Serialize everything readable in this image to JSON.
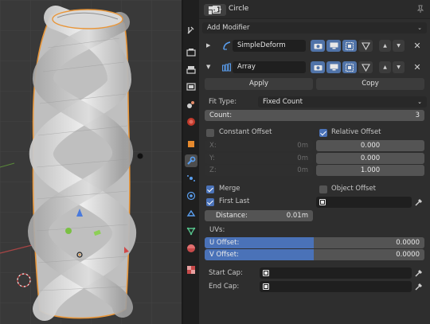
{
  "header": {
    "object_name": "Circle",
    "editor_type_icon": "properties-editor-icon",
    "object_icon": "mesh-object-icon",
    "pin_icon": "pin-icon"
  },
  "add_modifier": {
    "label": "Add Modifier"
  },
  "modifiers": [
    {
      "name": "SimpleDeform",
      "expanded": false,
      "icon": "simple-deform-icon"
    },
    {
      "name": "Array",
      "expanded": true,
      "icon": "array-modifier-icon"
    }
  ],
  "array": {
    "apply_label": "Apply",
    "copy_label": "Copy",
    "fit_type_label": "Fit Type:",
    "fit_type_value": "Fixed Count",
    "count_label": "Count:",
    "count_value": "3",
    "constant_offset_label": "Constant Offset",
    "constant_offset_checked": false,
    "relative_offset_label": "Relative Offset",
    "relative_offset_checked": true,
    "constant": {
      "x_label": "X:",
      "x_value": "0m",
      "y_label": "Y:",
      "y_value": "0m",
      "z_label": "Z:",
      "z_value": "0m"
    },
    "relative": {
      "x_value": "0.000",
      "y_value": "0.000",
      "z_value": "1.000"
    },
    "merge_label": "Merge",
    "merge_checked": true,
    "object_offset_label": "Object Offset",
    "object_offset_checked": false,
    "first_last_label": "First Last",
    "first_last_checked": true,
    "distance_label": "Distance:",
    "distance_value": "0.01m",
    "uvs_label": "UVs:",
    "u_offset_label": "U Offset:",
    "u_offset_value": "0.0000",
    "v_offset_label": "V Offset:",
    "v_offset_value": "0.0000",
    "start_cap_label": "Start Cap:",
    "end_cap_label": "End Cap:"
  },
  "tool_tabs": [
    {
      "icon": "tool-settings-icon"
    },
    {
      "icon": "render-icon"
    },
    {
      "icon": "output-icon"
    },
    {
      "icon": "view-layer-icon"
    },
    {
      "icon": "scene-icon"
    },
    {
      "icon": "world-icon"
    },
    {
      "icon": "object-icon"
    },
    {
      "icon": "modifier-wrench-icon",
      "active": true
    },
    {
      "icon": "particles-icon"
    },
    {
      "icon": "physics-icon"
    },
    {
      "icon": "constraints-icon"
    },
    {
      "icon": "object-data-icon"
    },
    {
      "icon": "material-icon"
    },
    {
      "icon": "texture-icon"
    }
  ],
  "colors": {
    "accent_blue": "#4a72b8",
    "panel_bg": "#2e2e2e",
    "viewport_bg": "#3a3a3a",
    "selection_outline": "#e8963a"
  }
}
